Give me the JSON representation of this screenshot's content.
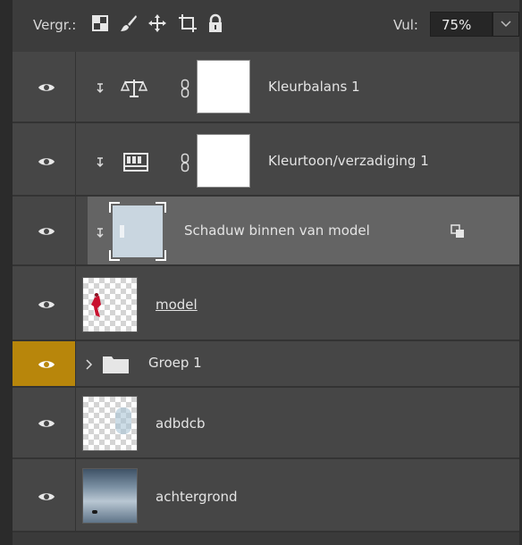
{
  "toolbar": {
    "lock_label": "Vergr.:",
    "fill_label": "Vul:",
    "fill_value": "75%",
    "icons": [
      "lock-transparent-pixels-icon",
      "lock-image-pixels-icon",
      "lock-position-icon",
      "artboard-lock-icon",
      "lock-all-icon"
    ]
  },
  "layers": [
    {
      "name": "Kleurbalans 1",
      "type": "adjustment",
      "icon": "color-balance-icon",
      "clipped": true,
      "visible": true
    },
    {
      "name": "Kleurtoon/verzadiging 1",
      "type": "adjustment",
      "icon": "hue-saturation-icon",
      "clipped": true,
      "visible": true
    },
    {
      "name": "Schaduw binnen van model",
      "type": "pixel",
      "clipped": true,
      "visible": true,
      "selected": true,
      "badge": "smart-object-icon"
    },
    {
      "name": "model",
      "type": "pixel",
      "visible": true
    },
    {
      "name": "Groep 1",
      "type": "group",
      "visible": true,
      "highlighted_eye": true,
      "collapsed": true
    },
    {
      "name": "adbdcb",
      "type": "pixel",
      "visible": true
    },
    {
      "name": "achtergrond",
      "type": "pixel",
      "visible": true
    }
  ],
  "colors": {
    "panel_bg": "#3a3a3a",
    "row_bg": "#464646",
    "selected_bg": "#646464",
    "eye_highlight": "#b8860b"
  }
}
